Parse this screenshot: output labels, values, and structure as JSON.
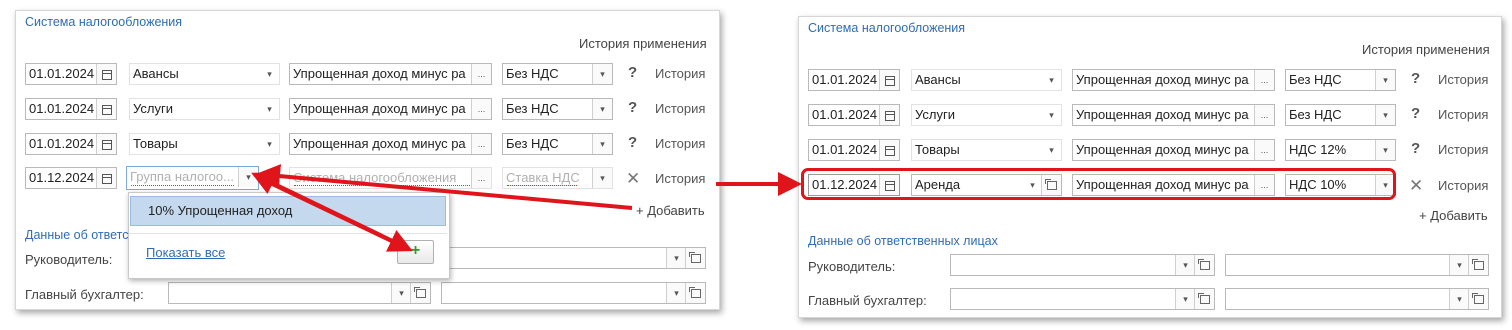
{
  "left": {
    "section_title": "Система налогообложения",
    "history_header": "История применения",
    "rows": [
      {
        "date": "01.01.2024",
        "type": "Авансы",
        "system": "Упрощенная доход минус ра",
        "vat": "Без НДС",
        "help": "?",
        "history": "История"
      },
      {
        "date": "01.01.2024",
        "type": "Услуги",
        "system": "Упрощенная доход минус ра",
        "vat": "Без НДС",
        "help": "?",
        "history": "История"
      },
      {
        "date": "01.01.2024",
        "type": "Товары",
        "system": "Упрощенная доход минус ра",
        "vat": "Без НДС",
        "help": "?",
        "history": "История"
      }
    ],
    "new_row": {
      "date": "01.12.2024",
      "type_placeholder": "Группа налогоо...",
      "system_placeholder": "Система налогообложения",
      "vat_placeholder": "Ставка НДС",
      "remove": "✕",
      "history": "История"
    },
    "add": "+ Добавить",
    "responsible_title": "Данные об ответс",
    "head_label": "Руководитель:",
    "accountant_label": "Главный бухгалтер:",
    "dropdown": {
      "item": "10% Упрощенная доход",
      "show_all": "Показать все",
      "add_icon": "+"
    }
  },
  "right": {
    "section_title": "Система налогообложения",
    "history_header": "История применения",
    "rows": [
      {
        "date": "01.01.2024",
        "type": "Авансы",
        "system": "Упрощенная доход минус ра",
        "vat": "Без НДС",
        "help": "?",
        "history": "История"
      },
      {
        "date": "01.01.2024",
        "type": "Услуги",
        "system": "Упрощенная доход минус ра",
        "vat": "Без НДС",
        "help": "?",
        "history": "История"
      },
      {
        "date": "01.01.2024",
        "type": "Товары",
        "system": "Упрощенная доход минус ра",
        "vat": "НДС 12%",
        "help": "?",
        "history": "История"
      }
    ],
    "new_row": {
      "date": "01.12.2024",
      "type": "Аренда",
      "system": "Упрощенная доход минус ра",
      "vat": "НДС 10%",
      "remove": "✕",
      "history": "История"
    },
    "add": "+ Добавить",
    "responsible_title": "Данные об ответственных лицах",
    "head_label": "Руководитель:",
    "accountant_label": "Главный бухгалтер:"
  },
  "colors": {
    "accent": "#2f6cb5",
    "annotation_red": "#e0141b",
    "selection": "#c5d9ee"
  }
}
